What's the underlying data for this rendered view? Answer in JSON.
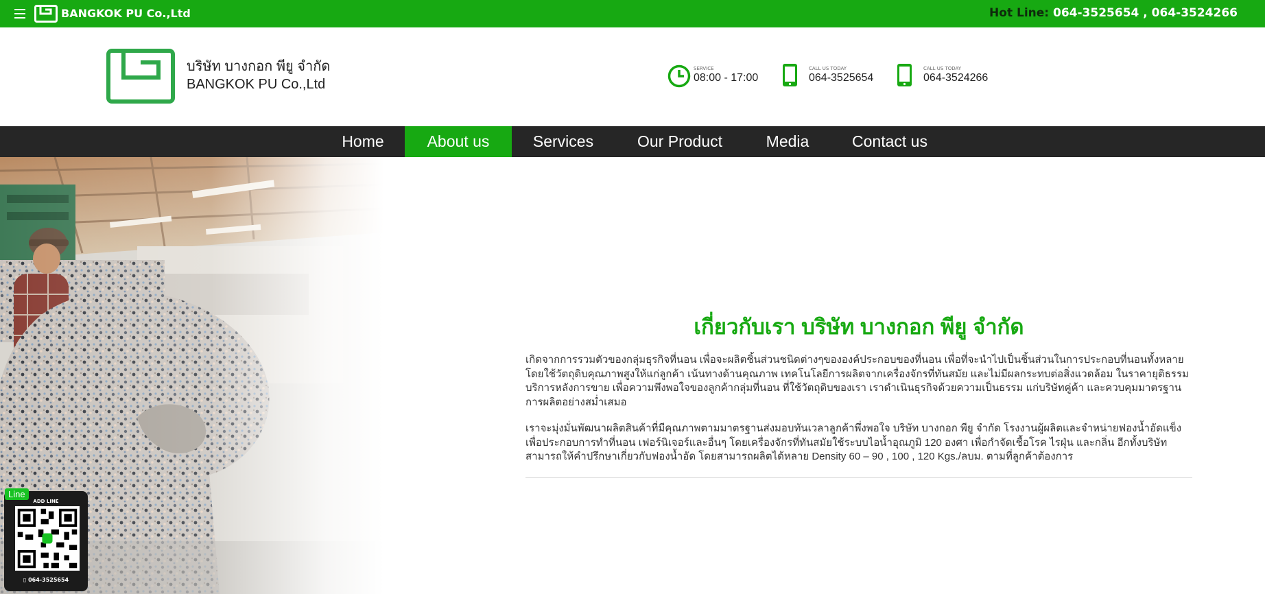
{
  "topbar": {
    "brand": "BANGKOK PU Co.,Ltd",
    "hotline_label": "Hot Line:",
    "hotline_1": "064-3525654",
    "separator": " , ",
    "hotline_2": "064-3524266"
  },
  "header": {
    "company_th": "บริษัท บางกอก พียู จำกัด",
    "company_en": "BANGKOK PU Co.,Ltd",
    "service": {
      "label": "SERVICE",
      "value": "08:00 - 17:00",
      "icon": "clock-icon"
    },
    "call1": {
      "label": "CALL US TODAY",
      "value": "064-3525654",
      "icon": "phone-icon"
    },
    "call2": {
      "label": "CALL US TODAY",
      "value": "064-3524266",
      "icon": "phone-icon"
    }
  },
  "nav": {
    "items": [
      {
        "label": "Home"
      },
      {
        "label": "About us"
      },
      {
        "label": "Services"
      },
      {
        "label": "Our Product"
      },
      {
        "label": "Media"
      },
      {
        "label": "Contact us"
      }
    ],
    "active": "About us"
  },
  "content": {
    "heading": "เกี่ยวกับเรา บริษัท บางกอก พียู จำกัด",
    "paragraph_1": "เกิดจากการรวมตัวของกลุ่มธุรกิจที่นอน เพื่อจะผลิตชิ้นส่วนชนิดต่างๆขององค์ประกอบของที่นอน เพื่อที่จะนำไปเป็นชิ้นส่วนในการประกอบที่นอนทั้งหลาย โดยใช้วัตถุดิบคุณภาพสูงให้แก่ลูกค้า เน้นทางด้านคุณภาพ เทคโนโลยีการผลิตจากเครื่องจักรที่ทันสมัย และไม่มีผลกระทบต่อสิ่งแวดล้อม ในราคายุติธรรม บริการหลังการขาย เพื่อความพึงพอใจของลูกค้ากลุ่มที่นอน ที่ใช้วัตถุดิบของเรา เราดำเนินธุรกิจด้วยความเป็นธรรม แก่บริษัทคู่ค้า และควบคุมมาตรฐานการผลิตอย่างสม่ำเสมอ",
    "paragraph_2": "เราจะมุ่งมั่นพัฒนาผลิตสินค้าที่มีคุณภาพตามมาตรฐานส่งมอบทันเวลาลูกค้าพึ่งพอใจ บริษัท บางกอก พียู จำกัด โรงงานผู้ผลิตและจำหน่ายฟองน้ำอัดแข็ง เพื่อประกอบการทำที่นอน เฟอร์นิเจอร์และอื่นๆ โดยเครื่องจักรที่ทันสมัยใช้ระบบไอน้ำอุณภูมิ 120 องศา เพื่อกำจัดเชื้อโรค ไรฝุ่น และกลิ่น อีกทั้งบริษัทสามารถให้คำปรึกษาเกี่ยวกับฟองน้ำอัด โดยสามารถผลิตได้หลาย Density 60 – 90 , 100 , 120 Kgs./ลบม. ตามที่ลูกค้าต้องการ"
  },
  "line_widget": {
    "tag": "Line",
    "title": "ADD LINE",
    "phone": "064-3525654"
  },
  "colors": {
    "brand_green": "#17a912",
    "nav_bg": "#262626",
    "heading_green": "#17a912"
  }
}
